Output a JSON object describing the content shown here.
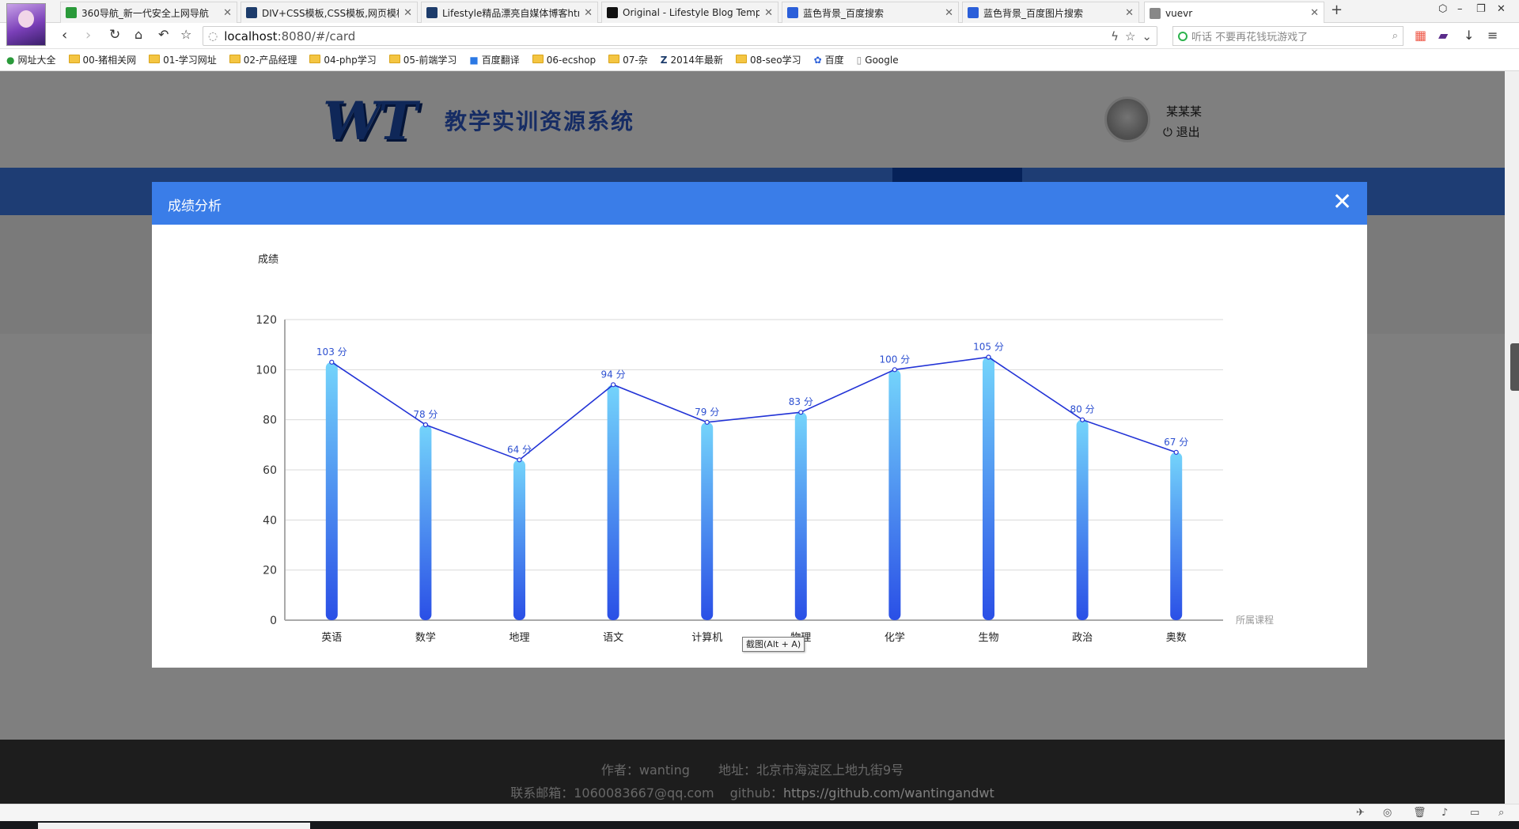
{
  "browser": {
    "tabs": [
      {
        "title": "360导航_新一代安全上网导航",
        "icon": "360-icon",
        "color": "#2a9a3a"
      },
      {
        "title": "DIV+CSS模板,CSS模板,网页模板",
        "icon": "template-icon",
        "color": "#1d3c6b"
      },
      {
        "title": "Lifestyle精品漂亮自媒体博客htm",
        "icon": "template-icon",
        "color": "#1d3c6b"
      },
      {
        "title": "Original - Lifestyle Blog Temp",
        "icon": "o-icon",
        "color": "#111111"
      },
      {
        "title": "蓝色背景_百度搜索",
        "icon": "baidu-icon",
        "color": "#2b5fd9"
      },
      {
        "title": "蓝色背景_百度图片搜索",
        "icon": "baidu-icon",
        "color": "#2b5fd9"
      },
      {
        "title": "vuevr",
        "icon": "page-icon",
        "color": "#888888",
        "active": true
      }
    ],
    "url_host": "localhost",
    "url_path": ":8080/#/card",
    "search_placeholder": "听话 不要再花钱玩游戏了",
    "bookmarks": [
      {
        "label": "网址大全",
        "icon": "360-icon"
      },
      {
        "label": "00-猪相关网",
        "icon": "folder-icon"
      },
      {
        "label": "01-学习网址",
        "icon": "folder-icon"
      },
      {
        "label": "02-产品经理",
        "icon": "folder-icon"
      },
      {
        "label": "04-php学习",
        "icon": "folder-icon"
      },
      {
        "label": "05-前端学习",
        "icon": "folder-icon"
      },
      {
        "label": "百度翻译",
        "icon": "translate-icon"
      },
      {
        "label": "06-ecshop",
        "icon": "folder-icon"
      },
      {
        "label": "07-杂",
        "icon": "folder-icon"
      },
      {
        "label": "2014年最新",
        "icon": "z-icon"
      },
      {
        "label": "08-seo学习",
        "icon": "folder-icon"
      },
      {
        "label": "百度",
        "icon": "baidu-icon"
      },
      {
        "label": "Google",
        "icon": "page-icon"
      }
    ]
  },
  "site": {
    "logo": "WT",
    "title": "教学实训资源系统",
    "username": "某某某",
    "logout": "退出",
    "footer": {
      "author": "作者：wanting",
      "address": "地址：北京市海淀区上地九街9号",
      "email": "联系邮箱：1060083667@qq.com",
      "github_label": "github：",
      "github_url": "https://github.com/wantingandwt"
    }
  },
  "modal": {
    "title": "成绩分析",
    "close_icon": "close-icon"
  },
  "tooltip": "截图(Alt + A)",
  "colors": {
    "modal_header": "#3a7de8",
    "bar_top": "#74d4fb",
    "bar_bottom": "#2a4fe6",
    "line": "#2233d6",
    "label": "#2c4fd0"
  },
  "chart_data": {
    "type": "bar",
    "ylabel": "成绩",
    "xlabel": "所属课程",
    "categories": [
      "英语",
      "数学",
      "地理",
      "语文",
      "计算机",
      "物理",
      "化学",
      "生物",
      "政治",
      "奥数"
    ],
    "series": [
      {
        "type": "bar",
        "values": [
          103,
          78,
          64,
          94,
          79,
          83,
          100,
          105,
          80,
          67
        ]
      },
      {
        "type": "line",
        "values": [
          103,
          78,
          64,
          94,
          79,
          83,
          100,
          105,
          80,
          67
        ]
      }
    ],
    "value_suffix": " 分",
    "ylim": [
      0,
      120
    ],
    "yticks": [
      0,
      20,
      40,
      60,
      80,
      100,
      120
    ],
    "grid": true
  }
}
